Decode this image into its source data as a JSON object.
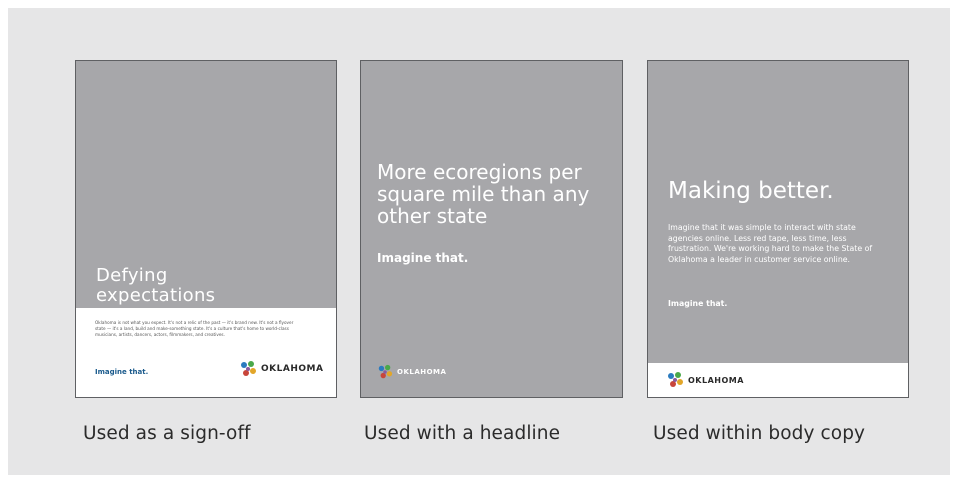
{
  "cards": [
    {
      "headline": "Defying expectations",
      "body": "Oklahoma is not what you expect. It's not a relic of the past — it's brand new. It's not a flyover state — it's a land, build and make-something state. It's a culture that's home to world-class musicians, artists, dancers, actors, filmmakers, and creatives.",
      "tagline": "Imagine that.",
      "logo_text": "OKLAHOMA",
      "caption": "Used as a sign-off"
    },
    {
      "headline": "More ecoregions per square mile than any other state",
      "tagline": "Imagine that.",
      "logo_text": "OKLAHOMA",
      "caption": "Used with a headline"
    },
    {
      "headline": "Making better.",
      "body": "Imagine that it was simple to interact with state agencies online. Less red tape, less time, less frustration. We're working hard to make the State of Oklahoma a leader in customer service online.",
      "tagline": "Imagine that.",
      "logo_text": "OKLAHOMA",
      "caption": "Used within body copy"
    }
  ],
  "colors": {
    "card_gray": "#a7a7aa",
    "background": "#e6e6e7",
    "tagline_blue": "#1a5a8c"
  },
  "icons": [
    "oklahoma-logo-icon"
  ]
}
